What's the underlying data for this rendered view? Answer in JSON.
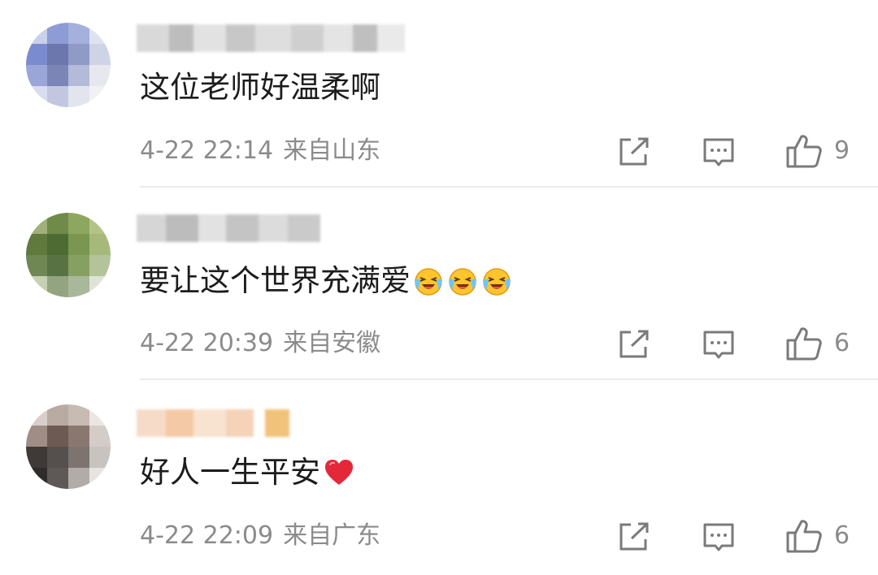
{
  "comments": [
    {
      "text": "这位老师好温柔啊",
      "date": "4-22 22:14",
      "location": "来自山东",
      "likes": "9"
    },
    {
      "text": "要让这个世界充满爱",
      "date": "4-22 20:39",
      "location": "来自安徽",
      "likes": "6",
      "emojis": [
        "crying-laugh-emoji",
        "crying-laugh-emoji",
        "crying-laugh-emoji"
      ]
    },
    {
      "text": "好人一生平安",
      "date": "4-22 22:09",
      "location": "来自广东",
      "likes": "6",
      "emojis": [
        "red-heart-emoji"
      ]
    }
  ],
  "icons": {
    "share": "share-icon",
    "comment": "comment-icon",
    "like": "thumbs-up-icon"
  },
  "colors": {
    "text": "#1c1c1c",
    "meta": "#8b8b8b",
    "icon": "#7a7a7a",
    "divider": "#ececec"
  }
}
